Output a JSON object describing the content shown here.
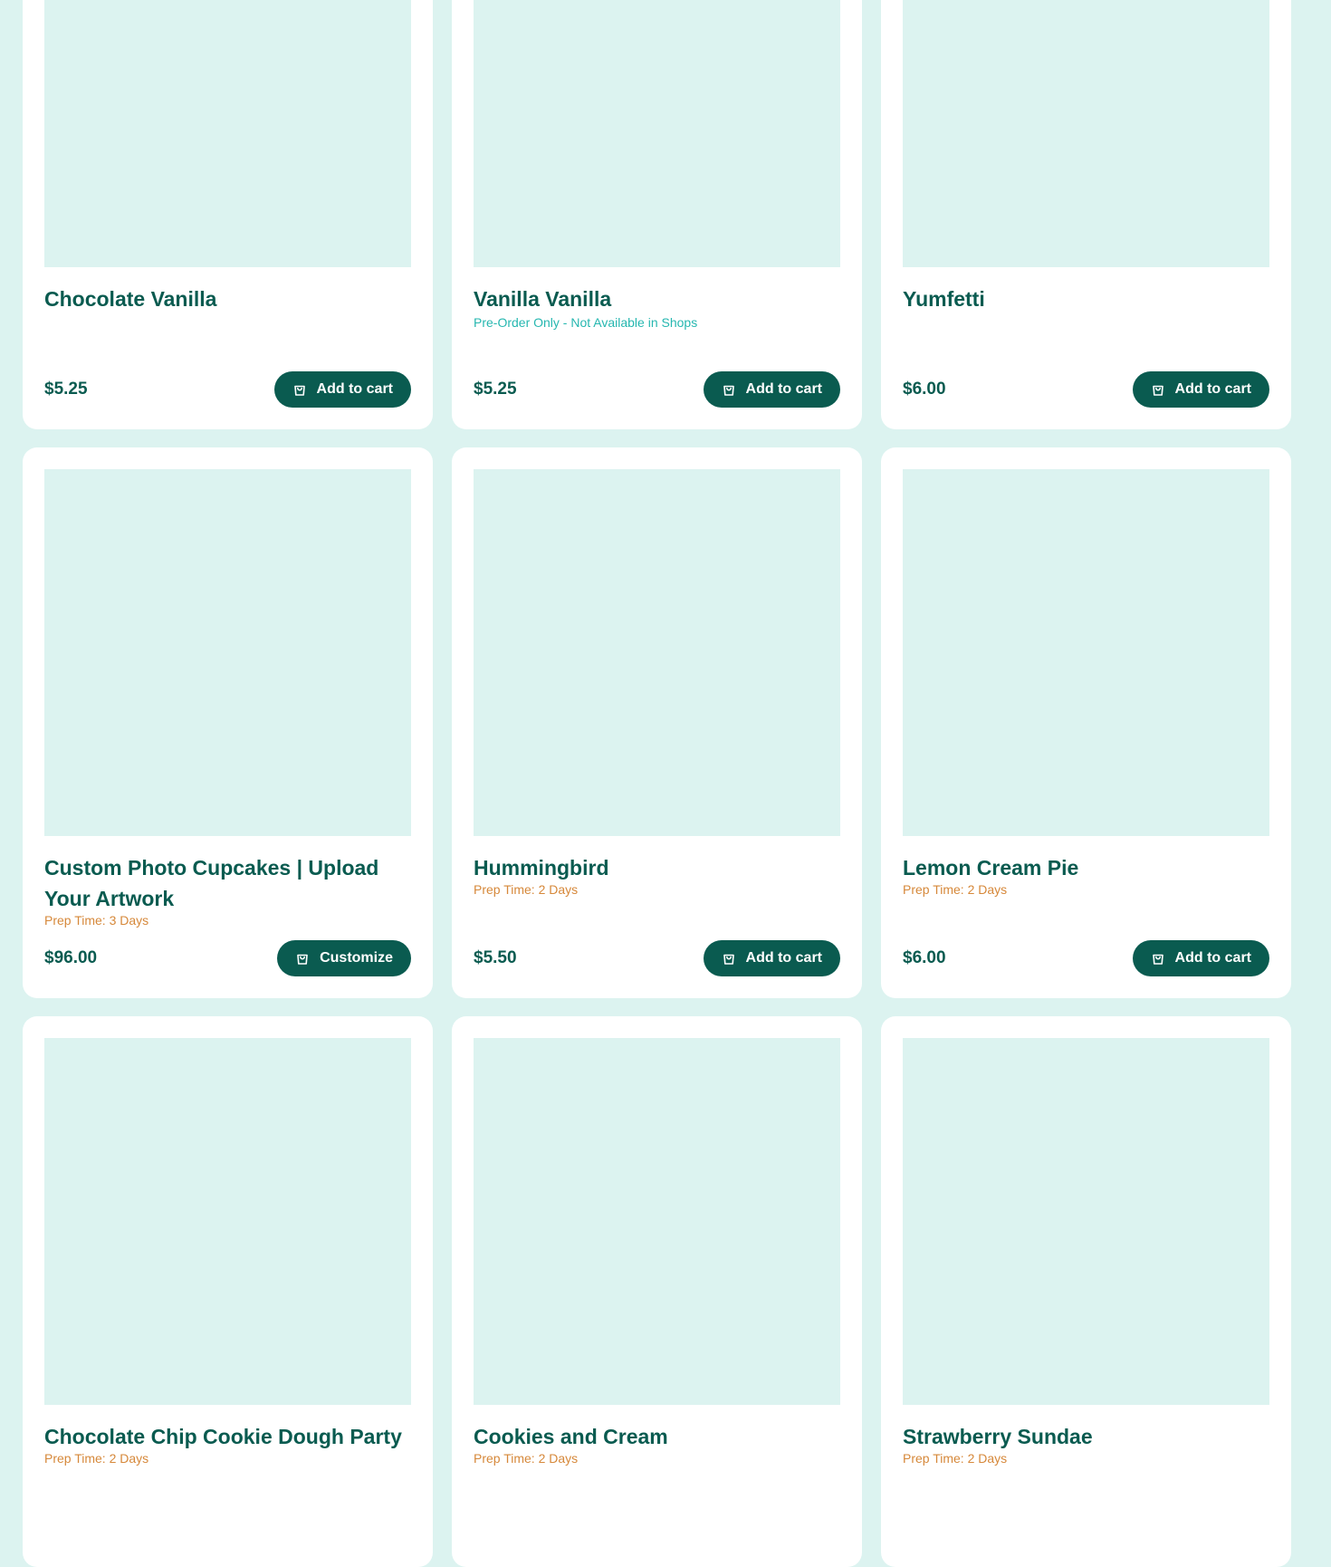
{
  "products": [
    {
      "name": "Chocolate Vanilla",
      "note": "",
      "note_type": "",
      "price": "$5.25",
      "button": "Add to cart"
    },
    {
      "name": "Vanilla Vanilla",
      "note": "Pre-Order Only - Not Available in Shops",
      "note_type": "preorder",
      "price": "$5.25",
      "button": "Add to cart"
    },
    {
      "name": "Yumfetti",
      "note": "",
      "note_type": "",
      "price": "$6.00",
      "button": "Add to cart"
    },
    {
      "name": "Custom Photo Cupcakes | Upload Your Artwork",
      "note": "Prep Time: 3 Days",
      "note_type": "prep",
      "price": "$96.00",
      "button": "Customize"
    },
    {
      "name": "Hummingbird",
      "note": "Prep Time: 2 Days",
      "note_type": "prep",
      "price": "$5.50",
      "button": "Add to cart"
    },
    {
      "name": "Lemon Cream Pie",
      "note": "Prep Time: 2 Days",
      "note_type": "prep",
      "price": "$6.00",
      "button": "Add to cart"
    },
    {
      "name": "Chocolate Chip Cookie Dough Party",
      "note": "Prep Time: 2 Days",
      "note_type": "prep",
      "price": "",
      "button": ""
    },
    {
      "name": "Cookies and Cream",
      "note": "Prep Time: 2 Days",
      "note_type": "prep",
      "price": "",
      "button": ""
    },
    {
      "name": "Strawberry Sundae",
      "note": "Prep Time: 2 Days",
      "note_type": "prep",
      "price": "",
      "button": ""
    }
  ],
  "icons": {
    "button": "shopping-bag-icon"
  },
  "colors": {
    "background": "#dcf3f0",
    "primary": "#0a5b50",
    "prep_note": "#d6883a",
    "preorder_note": "#26b7b0"
  }
}
